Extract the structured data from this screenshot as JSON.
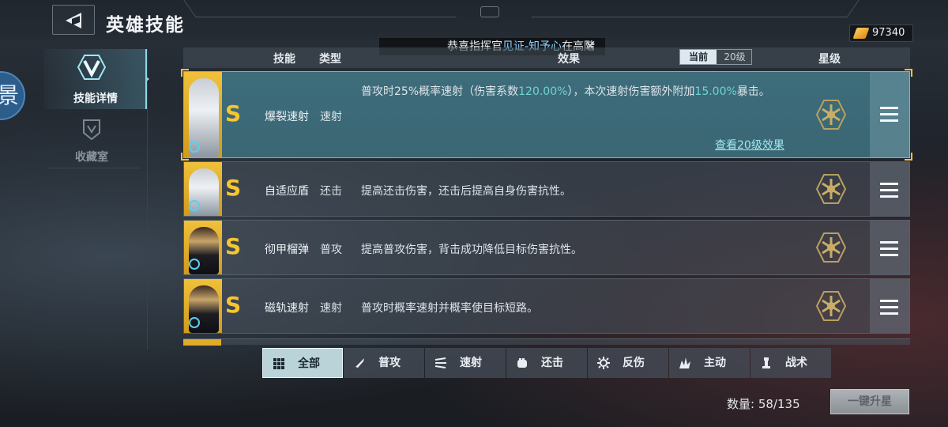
{
  "header": {
    "title": "英雄技能",
    "notice_prefix": "恭喜指挥官",
    "notice_highlight": "见证-知予心",
    "notice_suffix": "在高階",
    "currency_amount": "97340",
    "left_edge_char": "景"
  },
  "sidebar": {
    "items": [
      {
        "label": "技能详情",
        "icon": "v-emblem-icon",
        "active": true
      },
      {
        "label": "收藏室",
        "icon": "shield-icon",
        "active": false
      }
    ]
  },
  "table": {
    "headers": {
      "skill": "技能",
      "type": "类型",
      "effect": "效果",
      "star": "星级"
    },
    "toggle": {
      "current": "当前",
      "level20": "20级"
    },
    "view_level_link": "查看20级效果",
    "rows": [
      {
        "grade": "S",
        "name": "爆裂速射",
        "type": "速射",
        "portrait": "light",
        "selected": true,
        "effect_parts": [
          "普攻时25%概率速射（伤害系数",
          "120.00%",
          "），本次速射伤害额外附加",
          "15.00%",
          "暴击。"
        ]
      },
      {
        "grade": "S",
        "name": "自适应盾",
        "type": "还击",
        "portrait": "light",
        "selected": false,
        "effect": "提高还击伤害，还击后提高自身伤害抗性。"
      },
      {
        "grade": "S",
        "name": "彻甲榴弹",
        "type": "普攻",
        "portrait": "dark",
        "selected": false,
        "effect": "提高普攻伤害，背击成功降低目标伤害抗性。"
      },
      {
        "grade": "S",
        "name": "磁轨速射",
        "type": "速射",
        "portrait": "dark",
        "selected": false,
        "effect": "普攻时概率速射并概率使目标短路。"
      }
    ]
  },
  "filters": [
    {
      "label": "全部",
      "icon": "grid-icon",
      "active": true
    },
    {
      "label": "普攻",
      "icon": "bullet-icon",
      "active": false
    },
    {
      "label": "速射",
      "icon": "speed-lines-icon",
      "active": false
    },
    {
      "label": "还击",
      "icon": "fist-icon",
      "active": false
    },
    {
      "label": "反伤",
      "icon": "spiked-gear-icon",
      "active": false
    },
    {
      "label": "主动",
      "icon": "burst-icon",
      "active": false
    },
    {
      "label": "战术",
      "icon": "tower-icon",
      "active": false
    }
  ],
  "footer": {
    "count_label": "数量:",
    "count_value": "58/135",
    "upgrade_button": "一键升星"
  },
  "colors": {
    "accent_cyan": "#8fd6e8",
    "grade_gold": "#f6c630",
    "highlight_teal": "#6fd4cf"
  }
}
